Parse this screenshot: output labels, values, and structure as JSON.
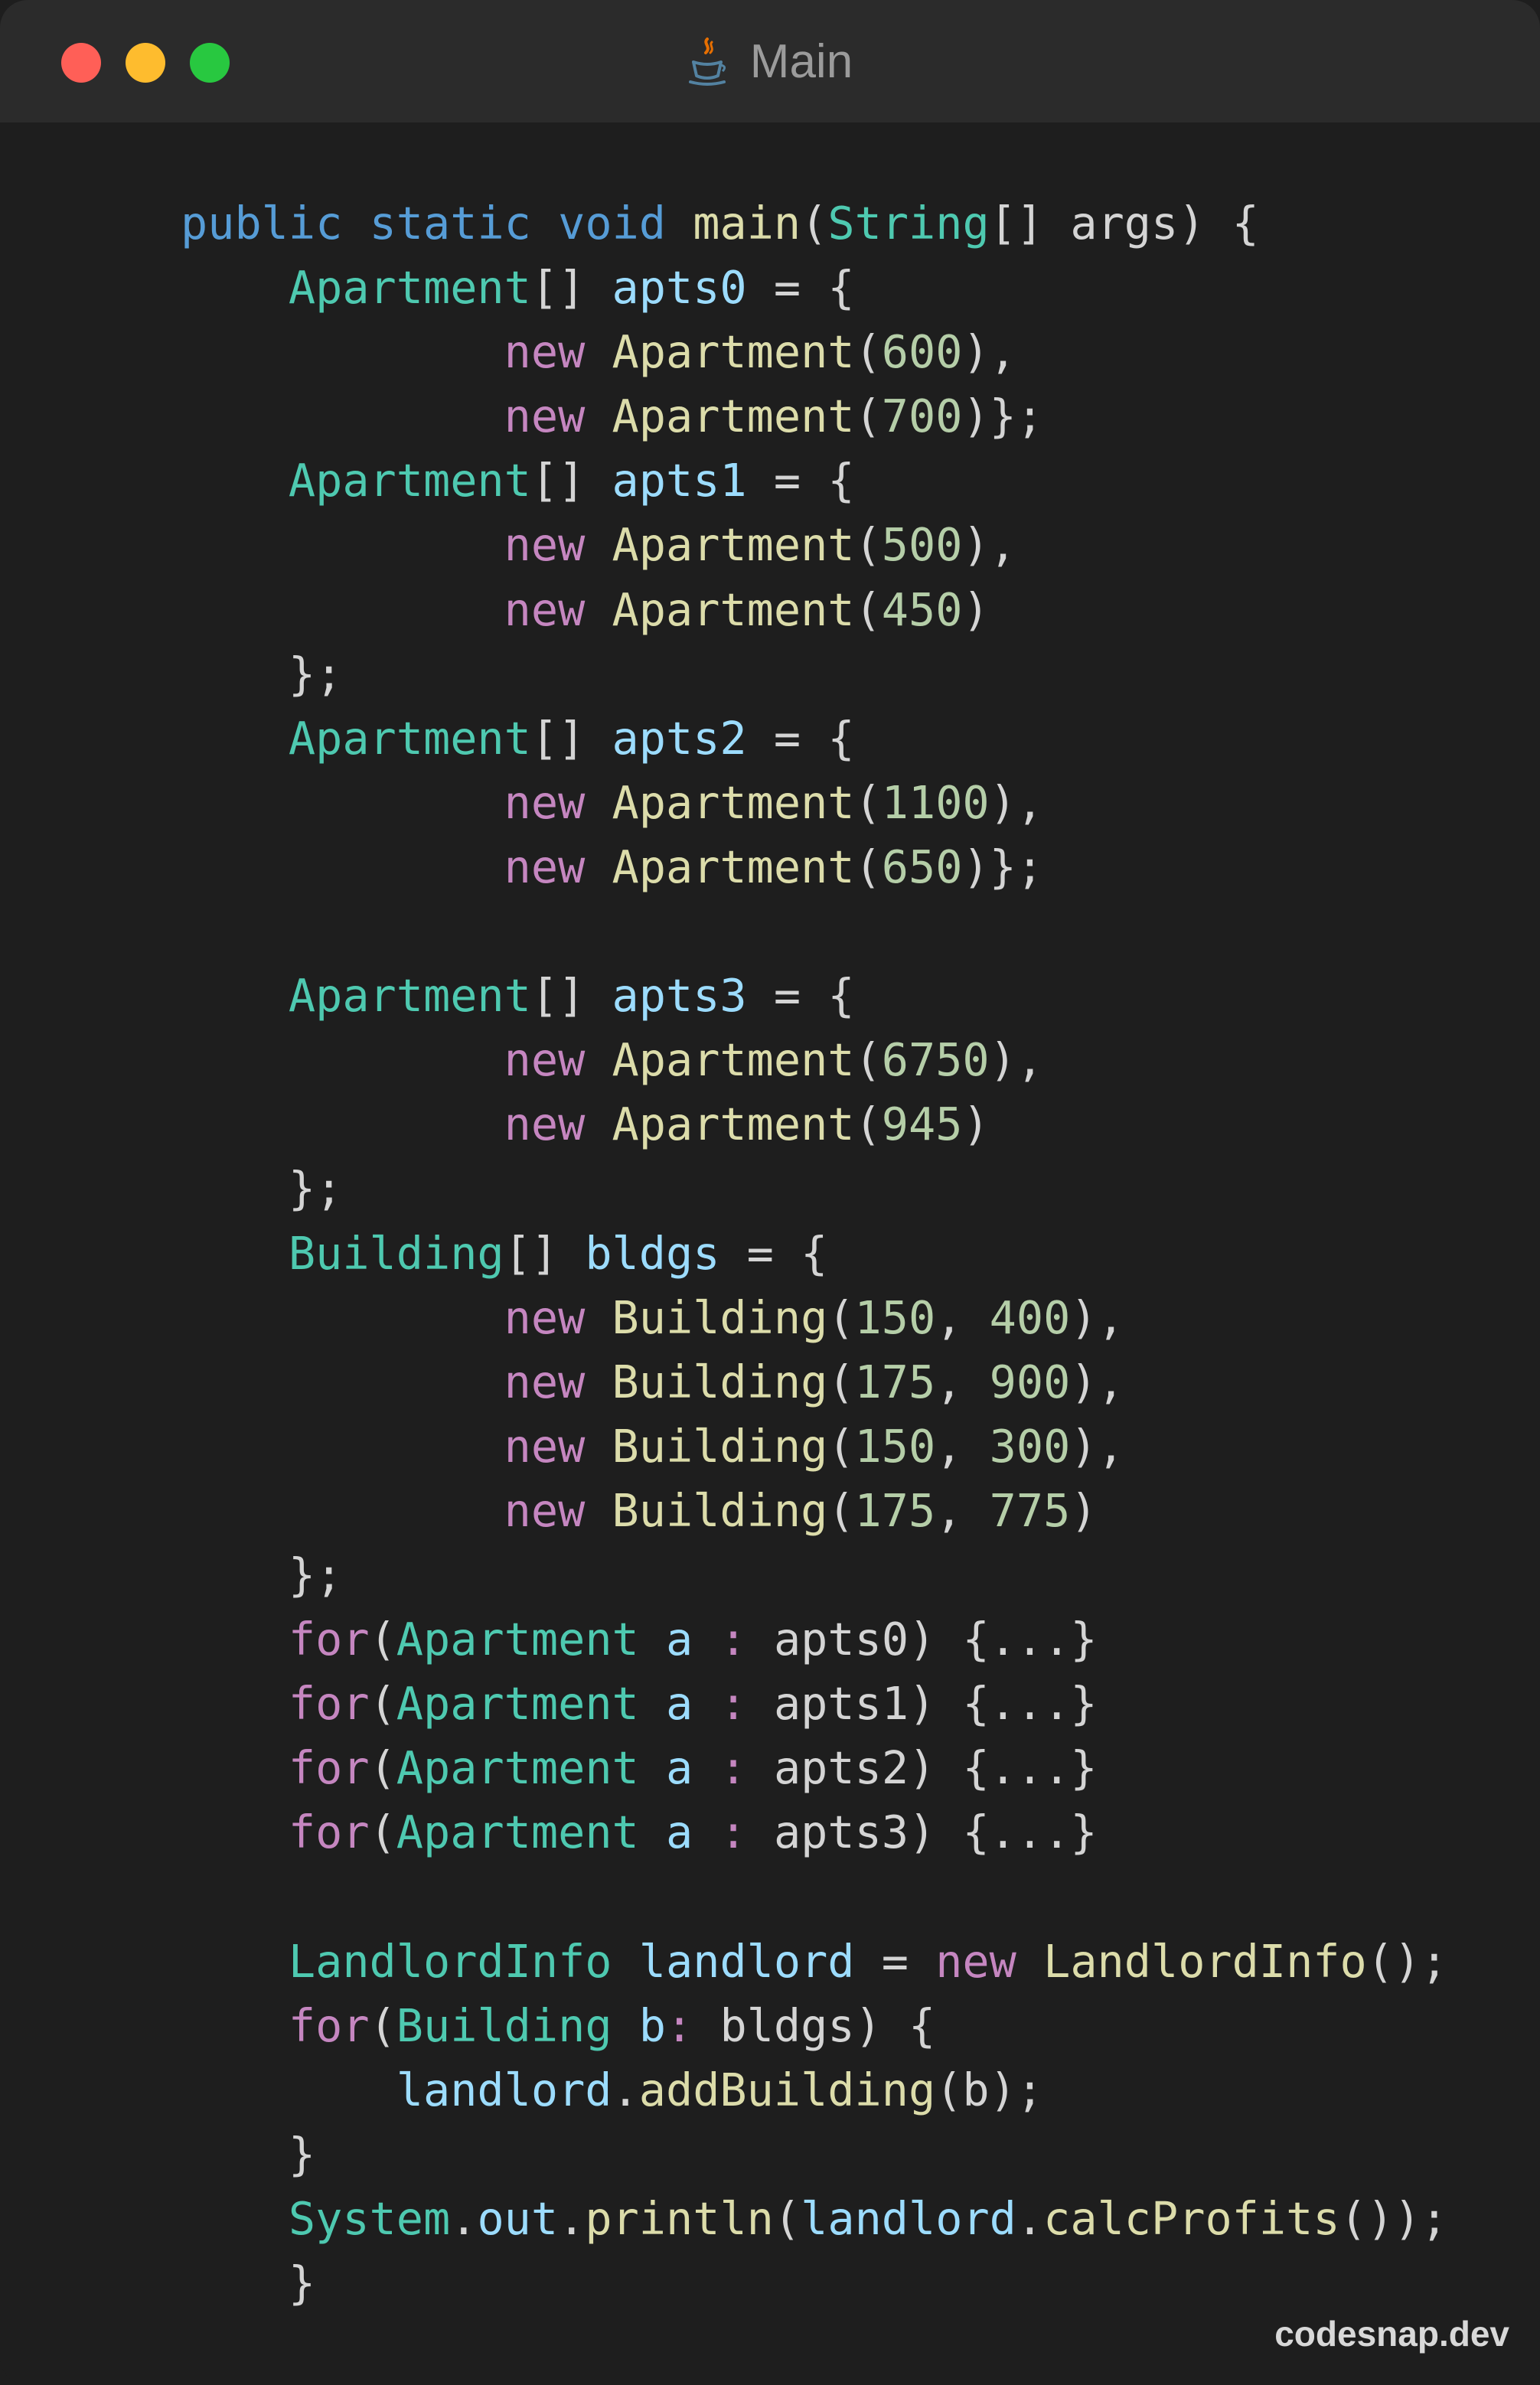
{
  "window": {
    "title": "Main",
    "file_icon": "java-cup-icon",
    "traffic_lights": [
      {
        "name": "close",
        "color": "#ff5f57"
      },
      {
        "name": "minimize",
        "color": "#febc2e"
      },
      {
        "name": "zoom",
        "color": "#28c840"
      }
    ]
  },
  "theme": {
    "background": "#1e1e1e",
    "titlebar": "#2b2b2b",
    "storage": "#569cd6",
    "type": "#4ec9b0",
    "keyword": "#c586c0",
    "function": "#dcdcaa",
    "variable": "#9cdcfe",
    "number": "#b5cea8",
    "plain": "#d4d4d4"
  },
  "code": {
    "lines": [
      [
        [
          "storage",
          "public"
        ],
        [
          "plain",
          " "
        ],
        [
          "storage",
          "static"
        ],
        [
          "plain",
          " "
        ],
        [
          "storage",
          "void"
        ],
        [
          "plain",
          " "
        ],
        [
          "function",
          "main"
        ],
        [
          "plain",
          "("
        ],
        [
          "type",
          "String"
        ],
        [
          "plain",
          "[] args) {"
        ]
      ],
      [
        [
          "plain",
          "    "
        ],
        [
          "type",
          "Apartment"
        ],
        [
          "plain",
          "[] "
        ],
        [
          "variable",
          "apts0"
        ],
        [
          "plain",
          " = {"
        ]
      ],
      [
        [
          "plain",
          "            "
        ],
        [
          "keyword",
          "new"
        ],
        [
          "plain",
          " "
        ],
        [
          "function",
          "Apartment"
        ],
        [
          "plain",
          "("
        ],
        [
          "number",
          "600"
        ],
        [
          "plain",
          "),"
        ]
      ],
      [
        [
          "plain",
          "            "
        ],
        [
          "keyword",
          "new"
        ],
        [
          "plain",
          " "
        ],
        [
          "function",
          "Apartment"
        ],
        [
          "plain",
          "("
        ],
        [
          "number",
          "700"
        ],
        [
          "plain",
          ")};"
        ]
      ],
      [
        [
          "plain",
          "    "
        ],
        [
          "type",
          "Apartment"
        ],
        [
          "plain",
          "[] "
        ],
        [
          "variable",
          "apts1"
        ],
        [
          "plain",
          " = {"
        ]
      ],
      [
        [
          "plain",
          "            "
        ],
        [
          "keyword",
          "new"
        ],
        [
          "plain",
          " "
        ],
        [
          "function",
          "Apartment"
        ],
        [
          "plain",
          "("
        ],
        [
          "number",
          "500"
        ],
        [
          "plain",
          "),"
        ]
      ],
      [
        [
          "plain",
          "            "
        ],
        [
          "keyword",
          "new"
        ],
        [
          "plain",
          " "
        ],
        [
          "function",
          "Apartment"
        ],
        [
          "plain",
          "("
        ],
        [
          "number",
          "450"
        ],
        [
          "plain",
          ")"
        ]
      ],
      [
        [
          "plain",
          "    };"
        ]
      ],
      [
        [
          "plain",
          "    "
        ],
        [
          "type",
          "Apartment"
        ],
        [
          "plain",
          "[] "
        ],
        [
          "variable",
          "apts2"
        ],
        [
          "plain",
          " = {"
        ]
      ],
      [
        [
          "plain",
          "            "
        ],
        [
          "keyword",
          "new"
        ],
        [
          "plain",
          " "
        ],
        [
          "function",
          "Apartment"
        ],
        [
          "plain",
          "("
        ],
        [
          "number",
          "1100"
        ],
        [
          "plain",
          "),"
        ]
      ],
      [
        [
          "plain",
          "            "
        ],
        [
          "keyword",
          "new"
        ],
        [
          "plain",
          " "
        ],
        [
          "function",
          "Apartment"
        ],
        [
          "plain",
          "("
        ],
        [
          "number",
          "650"
        ],
        [
          "plain",
          ")};"
        ]
      ],
      [],
      [
        [
          "plain",
          "    "
        ],
        [
          "type",
          "Apartment"
        ],
        [
          "plain",
          "[] "
        ],
        [
          "variable",
          "apts3"
        ],
        [
          "plain",
          " = {"
        ]
      ],
      [
        [
          "plain",
          "            "
        ],
        [
          "keyword",
          "new"
        ],
        [
          "plain",
          " "
        ],
        [
          "function",
          "Apartment"
        ],
        [
          "plain",
          "("
        ],
        [
          "number",
          "6750"
        ],
        [
          "plain",
          "),"
        ]
      ],
      [
        [
          "plain",
          "            "
        ],
        [
          "keyword",
          "new"
        ],
        [
          "plain",
          " "
        ],
        [
          "function",
          "Apartment"
        ],
        [
          "plain",
          "("
        ],
        [
          "number",
          "945"
        ],
        [
          "plain",
          ")"
        ]
      ],
      [
        [
          "plain",
          "    };"
        ]
      ],
      [
        [
          "plain",
          "    "
        ],
        [
          "type",
          "Building"
        ],
        [
          "plain",
          "[] "
        ],
        [
          "variable",
          "bldgs"
        ],
        [
          "plain",
          " = {"
        ]
      ],
      [
        [
          "plain",
          "            "
        ],
        [
          "keyword",
          "new"
        ],
        [
          "plain",
          " "
        ],
        [
          "function",
          "Building"
        ],
        [
          "plain",
          "("
        ],
        [
          "number",
          "150"
        ],
        [
          "plain",
          ", "
        ],
        [
          "number",
          "400"
        ],
        [
          "plain",
          "),"
        ]
      ],
      [
        [
          "plain",
          "            "
        ],
        [
          "keyword",
          "new"
        ],
        [
          "plain",
          " "
        ],
        [
          "function",
          "Building"
        ],
        [
          "plain",
          "("
        ],
        [
          "number",
          "175"
        ],
        [
          "plain",
          ", "
        ],
        [
          "number",
          "900"
        ],
        [
          "plain",
          "),"
        ]
      ],
      [
        [
          "plain",
          "            "
        ],
        [
          "keyword",
          "new"
        ],
        [
          "plain",
          " "
        ],
        [
          "function",
          "Building"
        ],
        [
          "plain",
          "("
        ],
        [
          "number",
          "150"
        ],
        [
          "plain",
          ", "
        ],
        [
          "number",
          "300"
        ],
        [
          "plain",
          "),"
        ]
      ],
      [
        [
          "plain",
          "            "
        ],
        [
          "keyword",
          "new"
        ],
        [
          "plain",
          " "
        ],
        [
          "function",
          "Building"
        ],
        [
          "plain",
          "("
        ],
        [
          "number",
          "175"
        ],
        [
          "plain",
          ", "
        ],
        [
          "number",
          "775"
        ],
        [
          "plain",
          ")"
        ]
      ],
      [
        [
          "plain",
          "    };"
        ]
      ],
      [
        [
          "plain",
          "    "
        ],
        [
          "keyword",
          "for"
        ],
        [
          "plain",
          "("
        ],
        [
          "type",
          "Apartment"
        ],
        [
          "plain",
          " "
        ],
        [
          "variable",
          "a"
        ],
        [
          "plain",
          " "
        ],
        [
          "keyword",
          ":"
        ],
        [
          "plain",
          " apts0) {...}"
        ]
      ],
      [
        [
          "plain",
          "    "
        ],
        [
          "keyword",
          "for"
        ],
        [
          "plain",
          "("
        ],
        [
          "type",
          "Apartment"
        ],
        [
          "plain",
          " "
        ],
        [
          "variable",
          "a"
        ],
        [
          "plain",
          " "
        ],
        [
          "keyword",
          ":"
        ],
        [
          "plain",
          " apts1) {...}"
        ]
      ],
      [
        [
          "plain",
          "    "
        ],
        [
          "keyword",
          "for"
        ],
        [
          "plain",
          "("
        ],
        [
          "type",
          "Apartment"
        ],
        [
          "plain",
          " "
        ],
        [
          "variable",
          "a"
        ],
        [
          "plain",
          " "
        ],
        [
          "keyword",
          ":"
        ],
        [
          "plain",
          " apts2) {...}"
        ]
      ],
      [
        [
          "plain",
          "    "
        ],
        [
          "keyword",
          "for"
        ],
        [
          "plain",
          "("
        ],
        [
          "type",
          "Apartment"
        ],
        [
          "plain",
          " "
        ],
        [
          "variable",
          "a"
        ],
        [
          "plain",
          " "
        ],
        [
          "keyword",
          ":"
        ],
        [
          "plain",
          " apts3) {...}"
        ]
      ],
      [],
      [
        [
          "plain",
          "    "
        ],
        [
          "type",
          "LandlordInfo"
        ],
        [
          "plain",
          " "
        ],
        [
          "variable",
          "landlord"
        ],
        [
          "plain",
          " = "
        ],
        [
          "keyword",
          "new"
        ],
        [
          "plain",
          " "
        ],
        [
          "function",
          "LandlordInfo"
        ],
        [
          "plain",
          "();"
        ]
      ],
      [
        [
          "plain",
          "    "
        ],
        [
          "keyword",
          "for"
        ],
        [
          "plain",
          "("
        ],
        [
          "type",
          "Building"
        ],
        [
          "plain",
          " "
        ],
        [
          "variable",
          "b"
        ],
        [
          "keyword",
          ":"
        ],
        [
          "plain",
          " bldgs) {"
        ]
      ],
      [
        [
          "plain",
          "        "
        ],
        [
          "variable",
          "landlord"
        ],
        [
          "plain",
          "."
        ],
        [
          "function",
          "addBuilding"
        ],
        [
          "plain",
          "(b);"
        ]
      ],
      [
        [
          "plain",
          "    }"
        ]
      ],
      [
        [
          "plain",
          "    "
        ],
        [
          "type",
          "System"
        ],
        [
          "plain",
          "."
        ],
        [
          "variable",
          "out"
        ],
        [
          "plain",
          "."
        ],
        [
          "function",
          "println"
        ],
        [
          "plain",
          "("
        ],
        [
          "variable",
          "landlord"
        ],
        [
          "plain",
          "."
        ],
        [
          "function",
          "calcProfits"
        ],
        [
          "plain",
          "());"
        ]
      ],
      [
        [
          "plain",
          "    }"
        ]
      ]
    ]
  },
  "watermark": "codesnap.dev"
}
